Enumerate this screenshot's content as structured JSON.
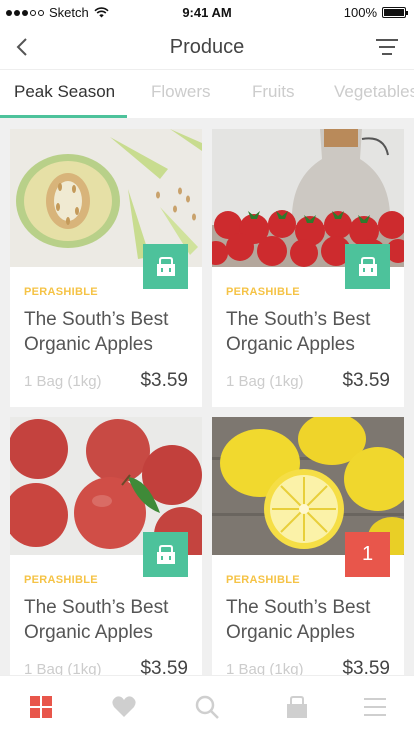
{
  "status_bar": {
    "carrier": "Sketch",
    "time": "9:41 AM",
    "battery": "100%"
  },
  "header": {
    "title": "Produce"
  },
  "tabs": [
    {
      "label": "Peak Season",
      "active": true
    },
    {
      "label": "Flowers",
      "active": false
    },
    {
      "label": "Fruits",
      "active": false
    },
    {
      "label": "Vegetables",
      "active": false
    }
  ],
  "products": [
    {
      "image": "melon",
      "tag": "PERASHIBLE",
      "name": "The South’s Best Organic Apples",
      "weight": "1 Bag (1kg)",
      "price": "$3.59",
      "action": "bag"
    },
    {
      "image": "strawberries",
      "tag": "PERASHIBLE",
      "name": "The South’s Best Organic Apples",
      "weight": "1 Bag (1kg)",
      "price": "$3.59",
      "action": "bag"
    },
    {
      "image": "red-apples",
      "tag": "PERASHIBLE",
      "name": "The South’s Best Organic Apples",
      "weight": "1 Bag (1kg)",
      "price": "$3.59",
      "action": "bag"
    },
    {
      "image": "lemons",
      "tag": "PERASHIBLE",
      "name": "The South’s Best Organic Apples",
      "weight": "1 Bag (1kg)",
      "price": "$3.59",
      "action": "count",
      "count": "1"
    }
  ],
  "bottom_nav": [
    {
      "icon": "grid-icon",
      "active": true
    },
    {
      "icon": "heart-icon",
      "active": false
    },
    {
      "icon": "search-icon",
      "active": false
    },
    {
      "icon": "bag-icon",
      "active": false
    },
    {
      "icon": "menu-icon",
      "active": false
    }
  ],
  "colors": {
    "accent": "#4dc29b",
    "tag": "#f5c346",
    "badge": "#e8564b",
    "nav_active": "#e8564b"
  }
}
